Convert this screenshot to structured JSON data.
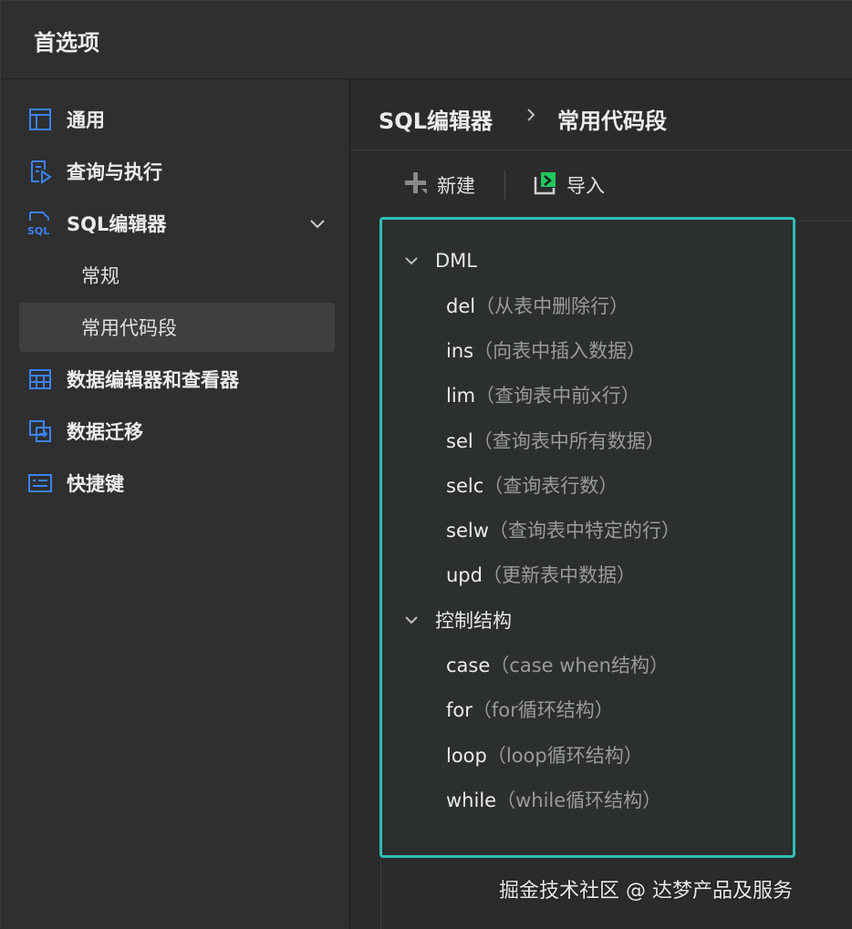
{
  "window": {
    "title": "首选项"
  },
  "sidebar": {
    "items": [
      {
        "label": "通用",
        "icon": "layout-icon"
      },
      {
        "label": "查询与执行",
        "icon": "query-run-icon"
      },
      {
        "label": "SQL编辑器",
        "icon": "sql-icon",
        "expanded": true
      },
      {
        "label": "常规",
        "sub": true
      },
      {
        "label": "常用代码段",
        "sub": true,
        "active": true
      },
      {
        "label": "数据编辑器和查看器",
        "icon": "table-icon"
      },
      {
        "label": "数据迁移",
        "icon": "migrate-icon"
      },
      {
        "label": "快捷键",
        "icon": "keyboard-icon"
      }
    ]
  },
  "breadcrumb": {
    "parent": "SQL编辑器",
    "current": "常用代码段"
  },
  "toolbar": {
    "new_label": "新建",
    "import_label": "导入"
  },
  "snippets": {
    "groups": [
      {
        "label": "DML",
        "items": [
          {
            "key": "del",
            "desc": "（从表中删除行）"
          },
          {
            "key": "ins",
            "desc": "（向表中插入数据）"
          },
          {
            "key": "lim",
            "desc": "（查询表中前x行）"
          },
          {
            "key": "sel",
            "desc": "（查询表中所有数据）"
          },
          {
            "key": "selc",
            "desc": "（查询表行数）"
          },
          {
            "key": "selw",
            "desc": "（查询表中特定的行）"
          },
          {
            "key": "upd",
            "desc": "（更新表中数据）"
          }
        ]
      },
      {
        "label": "控制结构",
        "items": [
          {
            "key": "case",
            "desc": "（case when结构）"
          },
          {
            "key": "for",
            "desc": "（for循环结构）"
          },
          {
            "key": "loop",
            "desc": "（loop循环结构）"
          },
          {
            "key": "while",
            "desc": "（while循环结构）"
          }
        ]
      }
    ]
  },
  "watermark": "掘金技术社区 @ 达梦产品及服务",
  "colors": {
    "accent": "#2fbfb4",
    "icon_blue": "#3b82f6",
    "icon_green": "#22c55e"
  }
}
